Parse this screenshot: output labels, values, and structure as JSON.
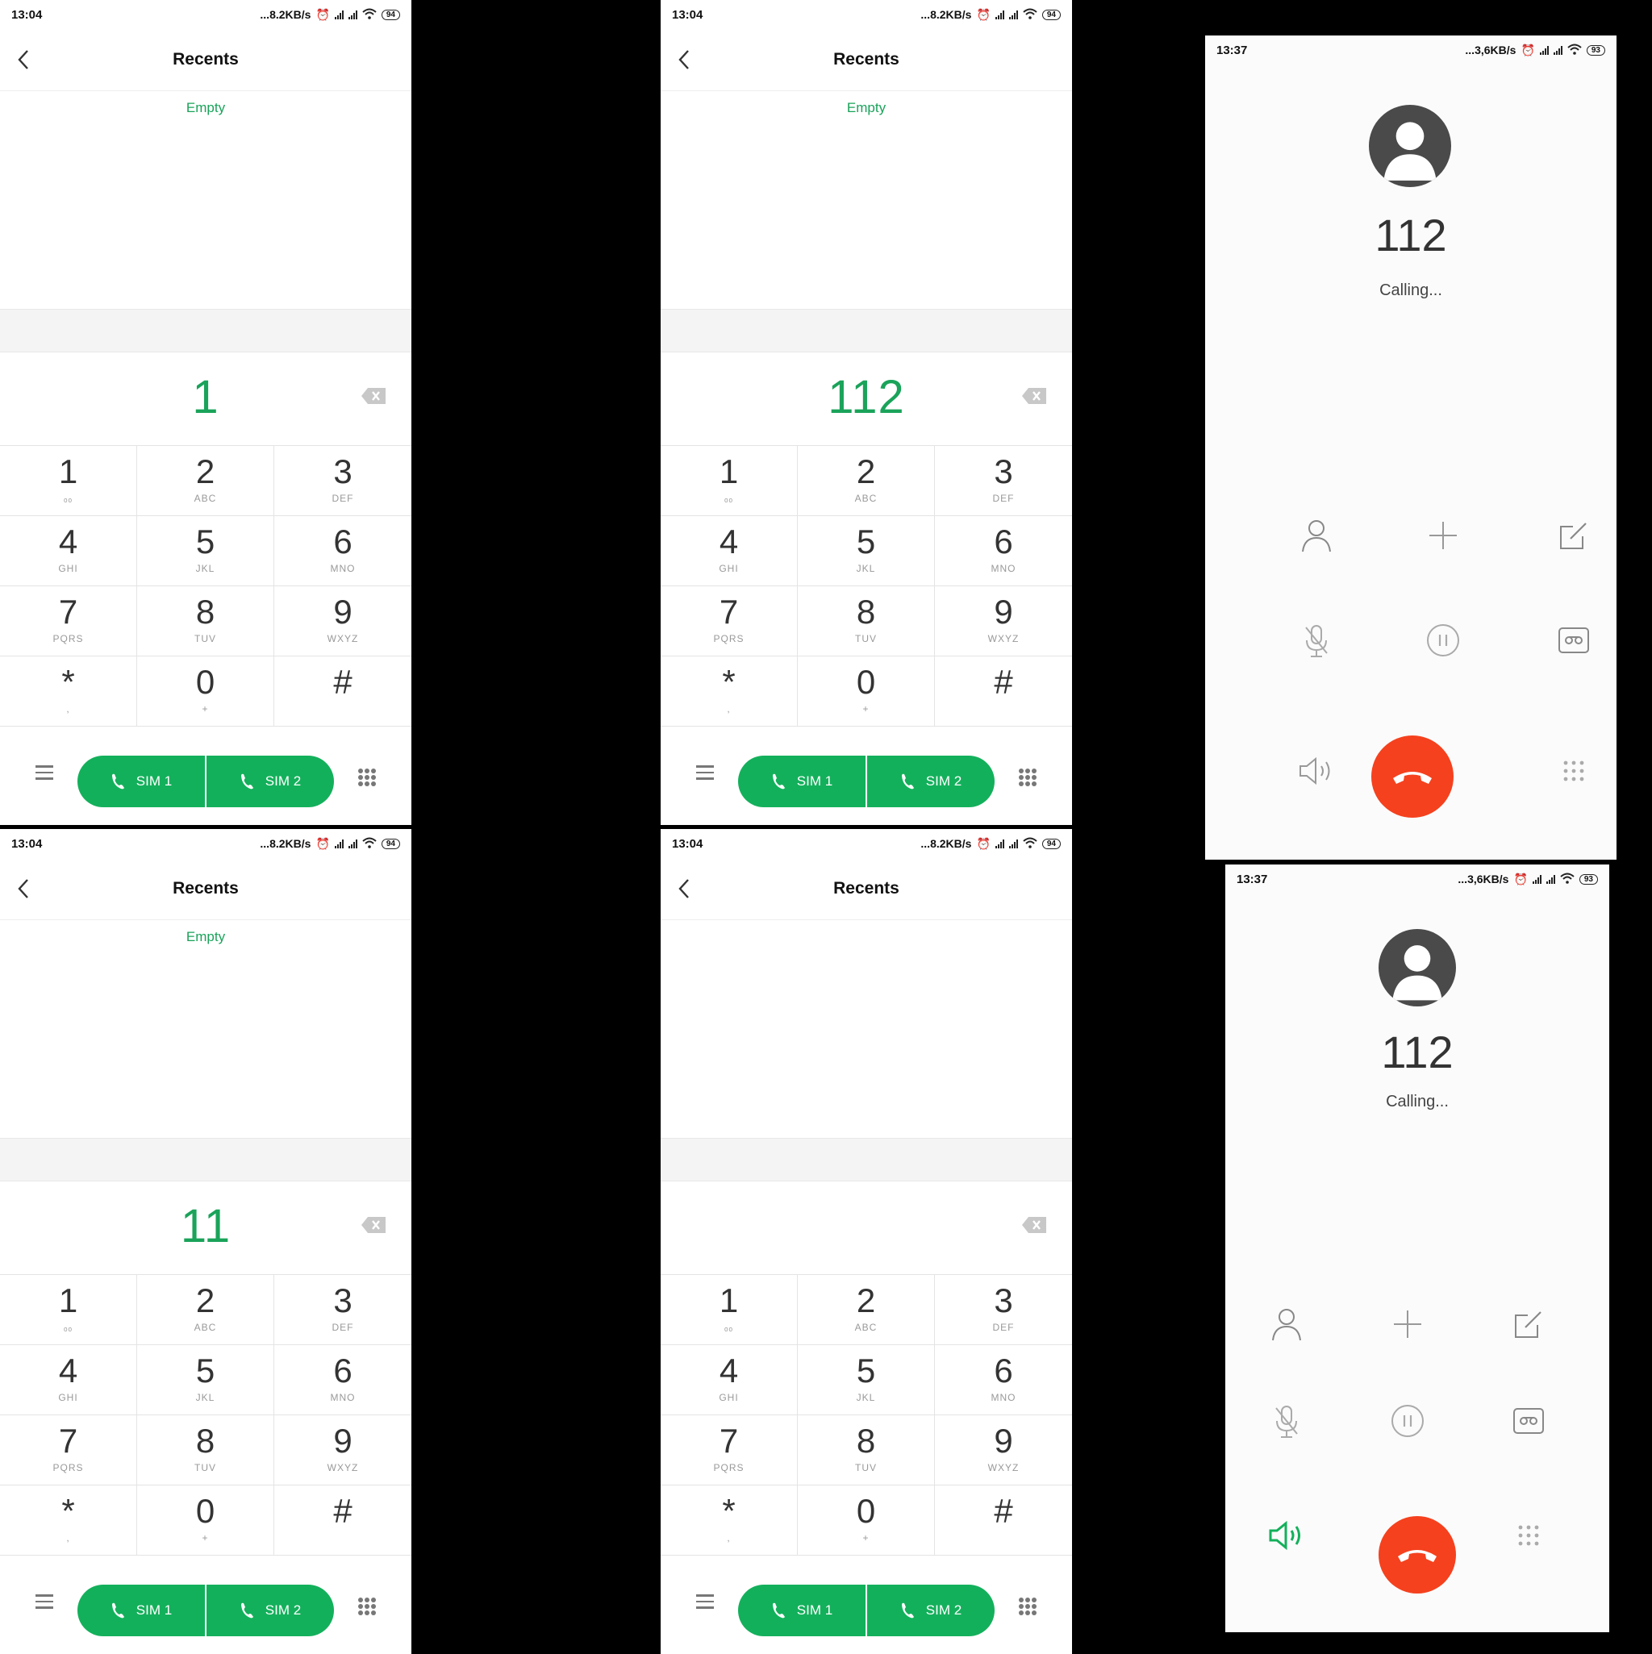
{
  "dialer": {
    "time": "13:04",
    "network_speed": "...8.2KB/s",
    "battery": "94",
    "header_title": "Recents",
    "empty_label": "Empty",
    "keys": [
      {
        "digit": "1",
        "letters": "ₒₒ"
      },
      {
        "digit": "2",
        "letters": "ABC"
      },
      {
        "digit": "3",
        "letters": "DEF"
      },
      {
        "digit": "4",
        "letters": "GHI"
      },
      {
        "digit": "5",
        "letters": "JKL"
      },
      {
        "digit": "6",
        "letters": "MNO"
      },
      {
        "digit": "7",
        "letters": "PQRS"
      },
      {
        "digit": "8",
        "letters": "TUV"
      },
      {
        "digit": "9",
        "letters": "WXYZ"
      },
      {
        "digit": "*",
        "letters": ","
      },
      {
        "digit": "0",
        "letters": "+"
      },
      {
        "digit": "#",
        "letters": ""
      }
    ],
    "sim1_label": "SIM 1",
    "sim2_label": "SIM 2"
  },
  "screens": [
    {
      "entered_number": "1",
      "show_empty": true
    },
    {
      "entered_number": "112",
      "show_empty": true
    },
    {
      "entered_number": "11",
      "show_empty": true
    },
    {
      "entered_number": "",
      "show_empty": false
    }
  ],
  "call": {
    "time": "13:37",
    "network_speed": "...3,6KB/s",
    "battery": "93",
    "number": "112",
    "state": "Calling...",
    "accent_colors": {
      "hangup": "#f5411e",
      "speaker_active": "#13b05b"
    }
  },
  "call_screens": [
    {
      "speaker_active": false
    },
    {
      "speaker_active": true
    }
  ]
}
